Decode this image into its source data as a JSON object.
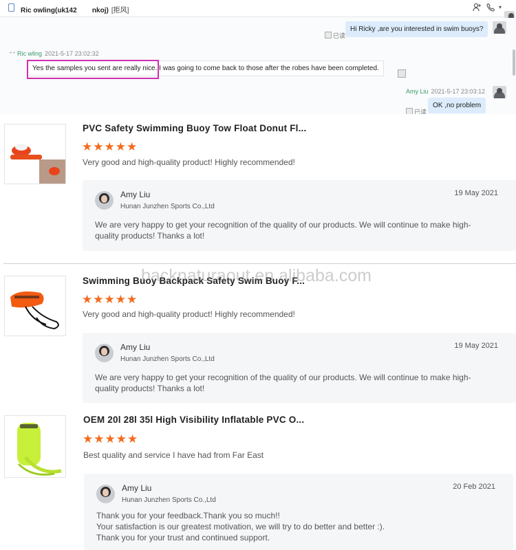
{
  "chat": {
    "contact_name": "Ric       owling(uk142        nkoj)",
    "contact_tag": "[拒风]",
    "messages": [
      {
        "text": "Hi Ricky ,are you interested in swim buoys?",
        "read": "已读"
      },
      {
        "sender": "Ric       wling",
        "time": "2021-5-17 23:02:32",
        "text": "Yes the samples you sent are really nice. I was going to come back to those after the robes have been completed."
      },
      {
        "sender": "Amy Liu",
        "time": "2021-5-17 23:03:12",
        "text": "OK ,no problem",
        "read": "已读"
      }
    ]
  },
  "watermark": "backnaturaout.en.alibaba.com",
  "reviews": [
    {
      "product_title": "PVC Safety Swimming Buoy Tow Float Donut Fl...",
      "rating": 5,
      "stars": "★★★★★",
      "comment": "Very good and high-quality product! Highly recommended!",
      "reply": {
        "name": "Amy Liu",
        "company": "Hunan Junzhen Sports Co.,Ltd",
        "date": "19 May 2021",
        "message": "We are very happy to get your recognition of the quality of our products. We will continue to make high-\nquality products! Thanks a lot!"
      }
    },
    {
      "product_title": "Swimming Buoy Backpack Safety Swim Buoy F...",
      "rating": 5,
      "stars": "★★★★★",
      "comment": "Very good and high-quality product! Highly recommended!",
      "reply": {
        "name": "Amy Liu",
        "company": "Hunan Junzhen Sports Co.,Ltd",
        "date": "19 May 2021",
        "message": "We are very happy to get your recognition of the quality of our products. We will continue to make high-\nquality products! Thanks a lot!"
      }
    },
    {
      "product_title": "OEM 20l 28l 35l High Visibility Inflatable PVC O...",
      "rating": 5,
      "stars": "★★★★★",
      "comment": "Best quality and service I have had from Far East",
      "reply": {
        "name": "Amy Liu",
        "company": "Hunan Junzhen Sports Co.,Ltd",
        "date": "20 Feb 2021",
        "message": "Thank you for your feedback.Thank you so much!!\nYour satisfaction is our greatest motivation, we will try to do better and better :).\nThank you for your trust and continued support."
      }
    }
  ],
  "colors": {
    "star": "#f26b1d",
    "highlight": "#d02fb0",
    "bubble_mine": "#dcecfc"
  },
  "icons": [
    "phone-icon",
    "add-contact-icon",
    "call-icon",
    "chevron-down-icon"
  ]
}
